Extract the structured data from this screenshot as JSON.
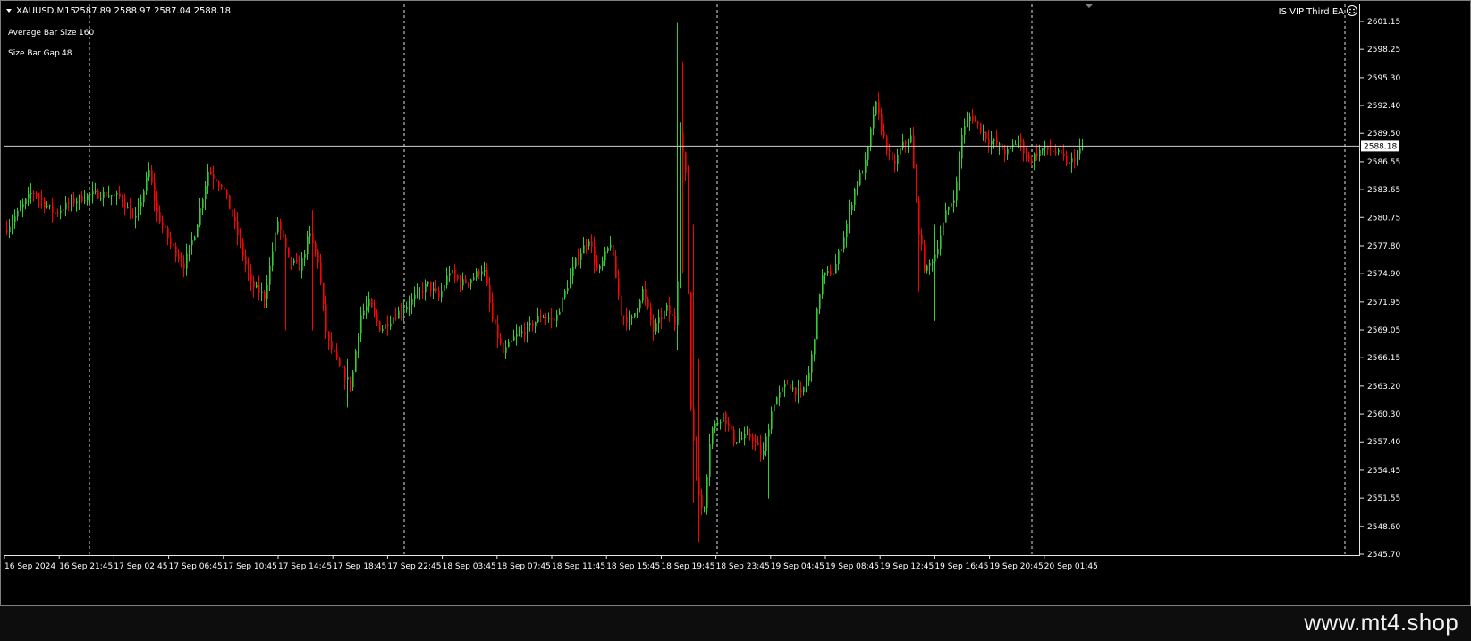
{
  "header": {
    "symbol_text": "XAUUSD,M15",
    "ohlc_text": "2587.89 2588.97 2587.04 2588.18",
    "ea_name": "IS VIP Third EA"
  },
  "info_panel": {
    "avg_bar_label": "Average Bar Size",
    "avg_bar_value": "160",
    "gap_label": "Size Bar Gap",
    "gap_value": "48"
  },
  "footer": {
    "site_url": "www.mt4.shop"
  },
  "colors": {
    "bull": "#32CD32",
    "bear": "#FF0000",
    "grid": "#E0E0E0",
    "background": "#000000",
    "axis_text": "#FFFFFF"
  },
  "chart_data": {
    "type": "candlestick",
    "symbol": "XAUUSD",
    "timeframe": "M15",
    "last_price": 2588.18,
    "last_price_label": "2588.18",
    "ylim": [
      2545.7,
      2602.5
    ],
    "y_ticks": [
      "2601.15",
      "2598.25",
      "2595.30",
      "2592.40",
      "2589.50",
      "2586.55",
      "2583.65",
      "2580.75",
      "2577.80",
      "2574.90",
      "2571.95",
      "2569.05",
      "2566.15",
      "2563.20",
      "2560.30",
      "2557.40",
      "2554.45",
      "2551.55",
      "2548.60",
      "2545.70"
    ],
    "x_ticks": [
      "16 Sep 2024",
      "16 Sep 21:45",
      "17 Sep 02:45",
      "17 Sep 06:45",
      "17 Sep 10:45",
      "17 Sep 14:45",
      "17 Sep 18:45",
      "17 Sep 22:45",
      "18 Sep 03:45",
      "18 Sep 07:45",
      "18 Sep 11:45",
      "18 Sep 15:45",
      "18 Sep 19:45",
      "18 Sep 23:45",
      "19 Sep 04:45",
      "19 Sep 08:45",
      "19 Sep 12:45",
      "19 Sep 16:45",
      "19 Sep 20:45",
      "20 Sep 01:45"
    ],
    "price_path": [
      [
        0,
        2578.8
      ],
      [
        20,
        2581.3
      ],
      [
        36,
        2583.5
      ],
      [
        60,
        2581.2
      ],
      [
        80,
        2582.4
      ],
      [
        100,
        2583.1
      ],
      [
        120,
        2583.2
      ],
      [
        135,
        2582.8
      ],
      [
        150,
        2580.2
      ],
      [
        166,
        2585.6
      ],
      [
        175,
        2581.2
      ],
      [
        190,
        2578.0
      ],
      [
        205,
        2575.8
      ],
      [
        218,
        2579.4
      ],
      [
        232,
        2585.6
      ],
      [
        248,
        2584.1
      ],
      [
        262,
        2580.0
      ],
      [
        280,
        2573.8
      ],
      [
        295,
        2572.5
      ],
      [
        310,
        2580.4
      ],
      [
        322,
        2576.3
      ],
      [
        335,
        2575.5
      ],
      [
        345,
        2579.1
      ],
      [
        355,
        2576.3
      ],
      [
        365,
        2568.1
      ],
      [
        378,
        2565.3
      ],
      [
        392,
        2563.2
      ],
      [
        402,
        2570.5
      ],
      [
        412,
        2571.8
      ],
      [
        425,
        2569.1
      ],
      [
        440,
        2570.5
      ],
      [
        462,
        2572.3
      ],
      [
        478,
        2573.8
      ],
      [
        490,
        2572.4
      ],
      [
        502,
        2575.2
      ],
      [
        515,
        2573.9
      ],
      [
        528,
        2574.5
      ],
      [
        540,
        2575.6
      ],
      [
        550,
        2570.1
      ],
      [
        562,
        2566.6
      ],
      [
        575,
        2568.3
      ],
      [
        590,
        2569.2
      ],
      [
        605,
        2570.6
      ],
      [
        620,
        2570.0
      ],
      [
        635,
        2574.0
      ],
      [
        645,
        2576.6
      ],
      [
        658,
        2578.6
      ],
      [
        668,
        2574.9
      ],
      [
        682,
        2578.2
      ],
      [
        694,
        2570.7
      ],
      [
        705,
        2569.8
      ],
      [
        718,
        2573.2
      ],
      [
        730,
        2569.0
      ],
      [
        745,
        2571.3
      ],
      [
        756,
        2569.4
      ],
      [
        760,
        2590.0
      ],
      [
        766,
        2585.0
      ],
      [
        772,
        2561.0
      ],
      [
        780,
        2552.0
      ],
      [
        786,
        2549.8
      ],
      [
        794,
        2558.5
      ],
      [
        808,
        2560.3
      ],
      [
        820,
        2557.6
      ],
      [
        840,
        2558.0
      ],
      [
        852,
        2555.8
      ],
      [
        864,
        2561.5
      ],
      [
        880,
        2563.5
      ],
      [
        895,
        2562.2
      ],
      [
        905,
        2564.8
      ],
      [
        918,
        2574.5
      ],
      [
        932,
        2575.2
      ],
      [
        945,
        2579.6
      ],
      [
        955,
        2583.7
      ],
      [
        968,
        2586.6
      ],
      [
        978,
        2592.8
      ],
      [
        988,
        2589.0
      ],
      [
        998,
        2586.0
      ],
      [
        1008,
        2588.2
      ],
      [
        1018,
        2589.1
      ],
      [
        1026,
        2580.0
      ],
      [
        1034,
        2575.0
      ],
      [
        1046,
        2577.2
      ],
      [
        1058,
        2581.5
      ],
      [
        1068,
        2583.3
      ],
      [
        1075,
        2589.5
      ],
      [
        1085,
        2591.4
      ],
      [
        1095,
        2590.1
      ],
      [
        1105,
        2588.8
      ],
      [
        1115,
        2588.3
      ],
      [
        1125,
        2587.4
      ],
      [
        1138,
        2588.9
      ],
      [
        1150,
        2586.7
      ],
      [
        1165,
        2587.9
      ],
      [
        1180,
        2587.6
      ],
      [
        1195,
        2586.3
      ],
      [
        1212,
        2588.2
      ]
    ]
  }
}
